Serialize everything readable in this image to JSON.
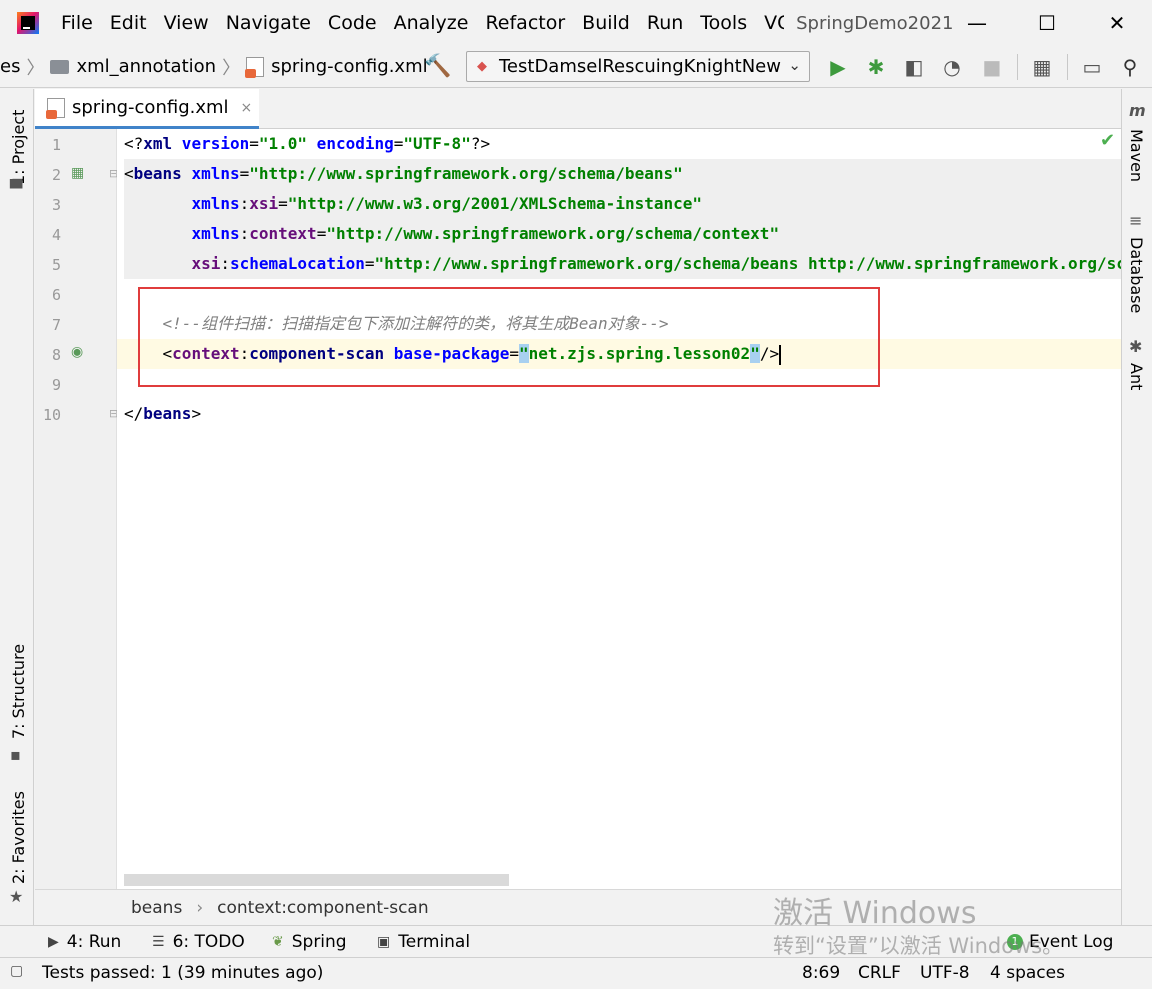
{
  "menu": {
    "items": [
      "File",
      "Edit",
      "View",
      "Navigate",
      "Code",
      "Analyze",
      "Refactor",
      "Build",
      "Run",
      "Tools",
      "VCS"
    ],
    "window_title": "SpringDemo2021"
  },
  "window_controls": {
    "minimize": "—",
    "maximize": "☐",
    "close": "✕"
  },
  "navbar": {
    "crumb_cut": "es",
    "crumbs": [
      "xml_annotation",
      "spring-config.xml"
    ],
    "run_config": "TestDamselRescuingKnightNew"
  },
  "left_tabs": {
    "project": "1: Project",
    "structure": "7: Structure",
    "favorites": "2: Favorites"
  },
  "right_tabs": {
    "maven": "Maven",
    "database": "Database",
    "ant": "Ant"
  },
  "editor_tab": {
    "label": "spring-config.xml",
    "close": "×"
  },
  "line_numbers": [
    "1",
    "2",
    "3",
    "4",
    "5",
    "6",
    "7",
    "8",
    "9",
    "10"
  ],
  "code": {
    "l1": {
      "p1": "<?",
      "tag": "xml",
      "a1": " version",
      "eq1": "=",
      "s1": "\"1.0\"",
      "a2": " encoding",
      "eq2": "=",
      "s2": "\"UTF-8\"",
      "p2": "?>"
    },
    "l2": {
      "p1": "<",
      "tag": "beans",
      "a1": " xmlns",
      "eq": "=",
      "s": "\"http://www.springframework.org/schema/beans\""
    },
    "l3": {
      "indent": "       ",
      "ns": "xmlns",
      "colon": ":",
      "a": "xsi",
      "eq": "=",
      "s": "\"http://www.w3.org/2001/XMLSchema-instance\""
    },
    "l4": {
      "indent": "       ",
      "ns": "xmlns",
      "colon": ":",
      "a": "context",
      "eq": "=",
      "s": "\"http://www.springframework.org/schema/context\""
    },
    "l5": {
      "indent": "       ",
      "ns": "xsi",
      "colon": ":",
      "a": "schemaLocation",
      "eq": "=",
      "s": "\"http://www.springframework.org/schema/beans http://www.springframework.org/schema/beans/spring-beans.xsd\""
    },
    "l7": {
      "indent": "    ",
      "comment": "<!--组件扫描：扫描指定包下添加注解符的类，将其生成Bean对象-->"
    },
    "l8": {
      "indent": "    ",
      "p1": "<",
      "ns": "context",
      "colon": ":",
      "tag": "component-scan",
      "a": " base-package",
      "eq": "=",
      "q1": "\"",
      "s": "net.zjs.spring.lesson02",
      "q2": "\"",
      "p2": "/>"
    },
    "l10": {
      "p1": "</",
      "tag": "beans",
      "p2": ">"
    }
  },
  "breadcrumbs": [
    "beans",
    "context:component-scan"
  ],
  "toolwindows": {
    "run": "4: Run",
    "todo": "6: TODO",
    "spring": "Spring",
    "terminal": "Terminal",
    "event_log": "Event Log",
    "event_log_count": "1"
  },
  "status": {
    "tests": "Tests passed: 1 (39 minutes ago)",
    "position": "8:69",
    "line_sep": "CRLF",
    "encoding": "UTF-8",
    "indent": "4 spaces"
  },
  "watermark": {
    "title": "激活 Windows",
    "subtitle": "转到“设置”以激活 Windows。"
  },
  "colors": {
    "accent": "#4083c9",
    "highlight_box": "#e03c3c",
    "run_green": "#3d9a3d",
    "string_green": "#008000",
    "tag_navy": "#000080"
  }
}
